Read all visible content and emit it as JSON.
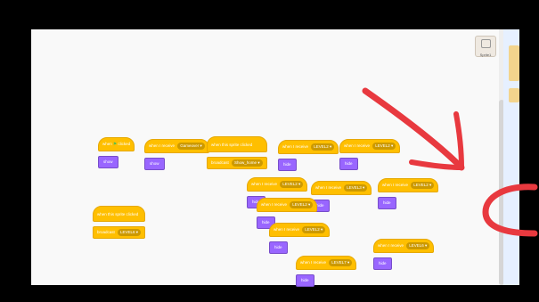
{
  "sprite_button_label": "Sprite1",
  "blocks": {
    "green_flag_hat": {
      "text_before": "when",
      "flag": "⚑",
      "text_after": "clicked",
      "cmd": "show"
    },
    "recv_gameover": {
      "text": "when I receive",
      "dd": "Gameover",
      "cmd": "show"
    },
    "sprite_click_broadcast": {
      "text": "when this sprite clicked",
      "cmd": "broadcast",
      "dd": "Show_home"
    },
    "recv_level2_a": {
      "text": "when I receive",
      "dd": "LEVEL2",
      "cmd": "hide"
    },
    "recv_level2_b": {
      "text": "when I receive",
      "dd": "LEVEL2",
      "cmd": "hide"
    },
    "recv_level2_c": {
      "text": "when I receive",
      "dd": "LEVEL2",
      "cmd": "hide"
    },
    "recv_level3_a": {
      "text": "when I receive",
      "dd": "LEVEL3",
      "cmd": "hide"
    },
    "recv_level2_d": {
      "text": "when I receive",
      "dd": "LEVEL2",
      "cmd": "hide"
    },
    "recv_level2_e": {
      "text": "when I receive",
      "dd": "LEVEL2",
      "cmd": "hide"
    },
    "sprite_click_level6": {
      "text": "when this sprite clicked",
      "cmd": "broadcast",
      "dd": "LEVEL6"
    },
    "recv_level2_f": {
      "text": "when I receive",
      "dd": "LEVEL2",
      "cmd": "hide"
    },
    "recv_level6": {
      "text": "when I receive",
      "dd": "LEVEL6",
      "cmd": "hide"
    },
    "recv_level7": {
      "text": "when I receive",
      "dd": "LEVEL7",
      "cmd": "hide"
    }
  },
  "colors": {
    "events": "#ffbf00",
    "looks": "#9966ff",
    "annotation": "#e8393f"
  }
}
